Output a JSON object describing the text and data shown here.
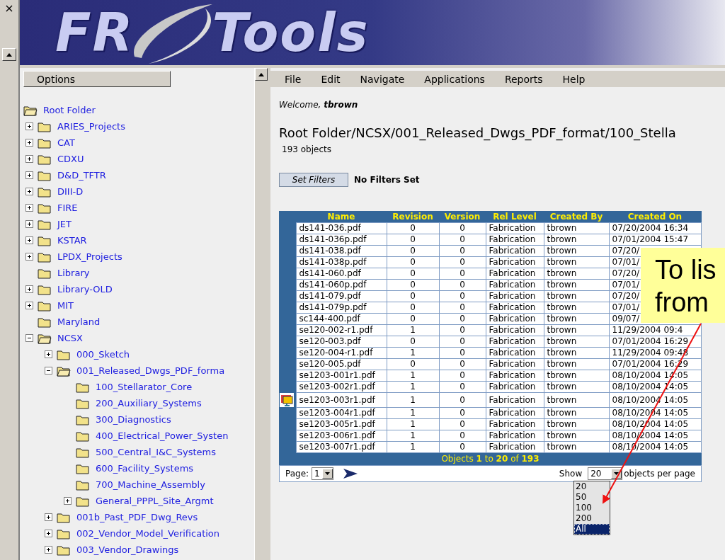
{
  "strip": {
    "close": "×"
  },
  "logo": {
    "left": "FR",
    "right": "Tools"
  },
  "options_button": "Options",
  "tree": [
    {
      "label": "Root Folder",
      "expandable": false,
      "expanded": true,
      "children": [
        {
          "label": "ARIES_Projects",
          "expandable": true,
          "expanded": false
        },
        {
          "label": "CAT",
          "expandable": true,
          "expanded": false
        },
        {
          "label": "CDXU",
          "expandable": true,
          "expanded": false
        },
        {
          "label": "D&D_TFTR",
          "expandable": true,
          "expanded": false
        },
        {
          "label": "DIII-D",
          "expandable": true,
          "expanded": false
        },
        {
          "label": "FIRE",
          "expandable": true,
          "expanded": false
        },
        {
          "label": "JET",
          "expandable": true,
          "expanded": false
        },
        {
          "label": "KSTAR",
          "expandable": true,
          "expanded": false
        },
        {
          "label": "LPDX_Projects",
          "expandable": true,
          "expanded": false
        },
        {
          "label": "Library",
          "expandable": false,
          "expanded": false
        },
        {
          "label": "Library-OLD",
          "expandable": true,
          "expanded": false
        },
        {
          "label": "MIT",
          "expandable": true,
          "expanded": false
        },
        {
          "label": "Maryland",
          "expandable": false,
          "expanded": false
        },
        {
          "label": "NCSX",
          "expandable": true,
          "expanded": true,
          "children": [
            {
              "label": "000_Sketch",
              "expandable": true,
              "expanded": false
            },
            {
              "label": "001_Released_Dwgs_PDF_forma",
              "expandable": true,
              "expanded": true,
              "children": [
                {
                  "label": "100_Stellarator_Core",
                  "expandable": false,
                  "expanded": false
                },
                {
                  "label": "200_Auxiliary_Systems",
                  "expandable": false,
                  "expanded": false
                },
                {
                  "label": "300_Diagnostics",
                  "expandable": false,
                  "expanded": false
                },
                {
                  "label": "400_Electrical_Power_Systen",
                  "expandable": false,
                  "expanded": false
                },
                {
                  "label": "500_Central_I&C_Systems",
                  "expandable": false,
                  "expanded": false
                },
                {
                  "label": "600_Facility_Systems",
                  "expandable": false,
                  "expanded": false
                },
                {
                  "label": "700_Machine_Assembly",
                  "expandable": false,
                  "expanded": false
                },
                {
                  "label": "General_PPPL_Site_Argmt",
                  "expandable": true,
                  "expanded": false
                }
              ]
            },
            {
              "label": "001b_Past_PDF_Dwg_Revs",
              "expandable": true,
              "expanded": false
            },
            {
              "label": "002_Vendor_Model_Verification",
              "expandable": true,
              "expanded": false
            },
            {
              "label": "003_Vendor_Drawings",
              "expandable": true,
              "expanded": false
            }
          ]
        }
      ]
    }
  ],
  "menu": [
    "File",
    "Edit",
    "Navigate",
    "Applications",
    "Reports",
    "Help"
  ],
  "welcome": "Welcome, **tbrown**",
  "path": "Root Folder/NCSX/001_Released_Dwgs_PDF_format/100_Stella",
  "count": "193 objects",
  "filter_button": "Set Filters",
  "filter_status": "No Filters Set",
  "table": {
    "columns": [
      "Name",
      "Revision",
      "Version",
      "Rel Level",
      "Created By",
      "Created On"
    ],
    "rows": [
      {
        "icon": false,
        "cells": [
          "ds141-036.pdf",
          "0",
          "0",
          "Fabrication",
          "tbrown",
          "07/20/2004 16:34"
        ]
      },
      {
        "icon": false,
        "cells": [
          "ds141-036p.pdf",
          "0",
          "0",
          "Fabrication",
          "tbrown",
          "07/01/2004 15:47"
        ]
      },
      {
        "icon": false,
        "cells": [
          "ds141-038.pdf",
          "0",
          "0",
          "Fabrication",
          "tbrown",
          "07/20/"
        ]
      },
      {
        "icon": false,
        "cells": [
          "ds141-038p.pdf",
          "0",
          "0",
          "Fabrication",
          "tbrown",
          "07/01/"
        ]
      },
      {
        "icon": false,
        "cells": [
          "ds141-060.pdf",
          "0",
          "0",
          "Fabrication",
          "tbrown",
          "07/20/"
        ]
      },
      {
        "icon": false,
        "cells": [
          "ds141-060p.pdf",
          "0",
          "0",
          "Fabrication",
          "tbrown",
          "07/01/"
        ]
      },
      {
        "icon": false,
        "cells": [
          "ds141-079.pdf",
          "0",
          "0",
          "Fabrication",
          "tbrown",
          "07/20/"
        ]
      },
      {
        "icon": false,
        "cells": [
          "ds141-079p.pdf",
          "0",
          "0",
          "Fabrication",
          "tbrown",
          "07/01/"
        ]
      },
      {
        "icon": false,
        "cells": [
          "sc144-400.pdf",
          "0",
          "0",
          "Fabrication",
          "tbrown",
          "09/07/"
        ]
      },
      {
        "icon": false,
        "cells": [
          "se120-002-r1.pdf",
          "1",
          "0",
          "Fabrication",
          "tbrown",
          "11/29/2004 09:4"
        ]
      },
      {
        "icon": false,
        "cells": [
          "se120-003.pdf",
          "0",
          "0",
          "Fabrication",
          "tbrown",
          "07/01/2004 16:29"
        ]
      },
      {
        "icon": false,
        "cells": [
          "se120-004-r1.pdf",
          "1",
          "0",
          "Fabrication",
          "tbrown",
          "11/29/2004 09:48"
        ]
      },
      {
        "icon": false,
        "cells": [
          "se120-005.pdf",
          "0",
          "0",
          "Fabrication",
          "tbrown",
          "07/01/2004 16:29"
        ]
      },
      {
        "icon": false,
        "cells": [
          "se1203-001r1.pdf",
          "1",
          "0",
          "Fabrication",
          "tbrown",
          "08/10/2004 14:05"
        ]
      },
      {
        "icon": false,
        "cells": [
          "se1203-002r1.pdf",
          "1",
          "0",
          "Fabrication",
          "tbrown",
          "08/10/2004 14:05"
        ]
      },
      {
        "icon": true,
        "cells": [
          "se1203-003r1.pdf",
          "1",
          "0",
          "Fabrication",
          "tbrown",
          "08/10/2004 14:05"
        ]
      },
      {
        "icon": false,
        "cells": [
          "se1203-004r1.pdf",
          "1",
          "0",
          "Fabrication",
          "tbrown",
          "08/10/2004 14:05"
        ]
      },
      {
        "icon": false,
        "cells": [
          "se1203-005r1.pdf",
          "1",
          "0",
          "Fabrication",
          "tbrown",
          "08/10/2004 14:05"
        ]
      },
      {
        "icon": false,
        "cells": [
          "se1203-006r1.pdf",
          "1",
          "0",
          "Fabrication",
          "tbrown",
          "08/10/2004 14:05"
        ]
      },
      {
        "icon": false,
        "cells": [
          "se1203-007r1.pdf",
          "1",
          "0",
          "Fabrication",
          "tbrown",
          "08/10/2004 14:05"
        ]
      }
    ],
    "footer": "Objects **1** to **20** of **193**"
  },
  "pager": {
    "page_label": "Page:",
    "page": "1",
    "show_label": "Show",
    "per_page": "20",
    "per_page_suffix": "objects per page",
    "options": [
      {
        "label": "20",
        "selected": false
      },
      {
        "label": "50",
        "selected": false
      },
      {
        "label": "100",
        "selected": false
      },
      {
        "label": "200",
        "selected": false
      },
      {
        "label": "All",
        "selected": true
      }
    ]
  },
  "callout": {
    "lines": [
      "To lis",
      "from"
    ]
  }
}
